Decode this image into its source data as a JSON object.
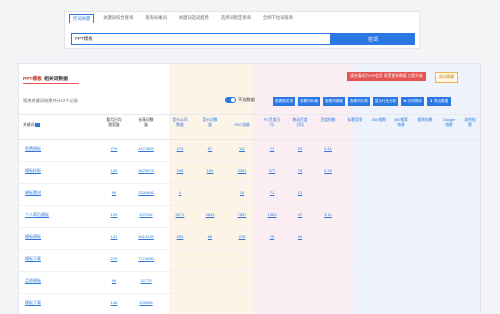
{
  "search": {
    "tabs": [
      "挖词关键",
      "关键词综合查询",
      "查询长尾词",
      "关键词选词趋势",
      "选择词稳定查询",
      "全网下拉词查询"
    ],
    "active_tab": 0,
    "query": "PPT模板",
    "button": "挖词"
  },
  "panel": {
    "title_kw": "PPT模板",
    "title_rest": "相关词数据",
    "warning": "请充值成为VIP会员 享受更多数据 立即升级",
    "export": "选词收藏",
    "info": "相关关键词结果共计12个记录",
    "toggle_label": "不选数据",
    "actions": [
      "查看相关词",
      "查看词价格",
      "查看词搜索",
      "查看词长尾",
      "显示行业分析",
      "分词排序",
      "导出数据"
    ]
  },
  "table": {
    "headers": [
      "关键词",
      "整月日均搜索量",
      "长尾词数量",
      "竞价公司数量",
      "竞价词数量",
      "SEO流量",
      "PC百度日均",
      "移动百度日均",
      "百度指数",
      "标题竞争",
      "360指数",
      "360搜索结果",
      "搜狗指数",
      "Google指数",
      "其他指数"
    ],
    "rows": [
      {
        "kw": "免费模板",
        "v": [
          "279",
          "4477805",
          "276",
          "57",
          "111",
          "71",
          "25",
          "3.41",
          "-",
          "-",
          "-",
          "-",
          "-",
          "-"
        ]
      },
      {
        "kw": "模板样板",
        "v": [
          "139",
          "3675973",
          "248",
          "159",
          "3351",
          "377",
          "75",
          "0.78",
          "-",
          "-",
          "-",
          "-",
          "-",
          "-"
        ]
      },
      {
        "kw": "模板素材",
        "v": [
          "95",
          "2339806",
          "4",
          "-",
          "15",
          "71",
          "21",
          "-",
          "-",
          "-",
          "-",
          "-",
          "-",
          "-"
        ]
      },
      {
        "kw": "个人简历模板",
        "v": [
          "129",
          "107264",
          "5071",
          "4801",
          "7587",
          "1983",
          "47",
          "3.11",
          "-",
          "-",
          "-",
          "-",
          "-",
          "-"
        ]
      },
      {
        "kw": "模板模板",
        "v": [
          "141",
          "4613132",
          "253",
          "89",
          "225",
          "75",
          "49",
          "-",
          "-",
          "-",
          "-",
          "-",
          "-",
          "-"
        ]
      },
      {
        "kw": "模板下载",
        "v": [
          "279",
          "7774450",
          "",
          "",
          "",
          "",
          "",
          "",
          "",
          "",
          "",
          "",
          "",
          ""
        ]
      },
      {
        "kw": "品质模板",
        "v": [
          "96",
          "32775",
          "",
          "",
          "",
          "",
          "",
          "",
          "",
          "",
          "",
          "",
          "",
          ""
        ]
      },
      {
        "kw": "模板下载",
        "v": [
          "148",
          "109528",
          "",
          "",
          "",
          "",
          "",
          "",
          "",
          "",
          "",
          "",
          "",
          ""
        ]
      }
    ]
  }
}
